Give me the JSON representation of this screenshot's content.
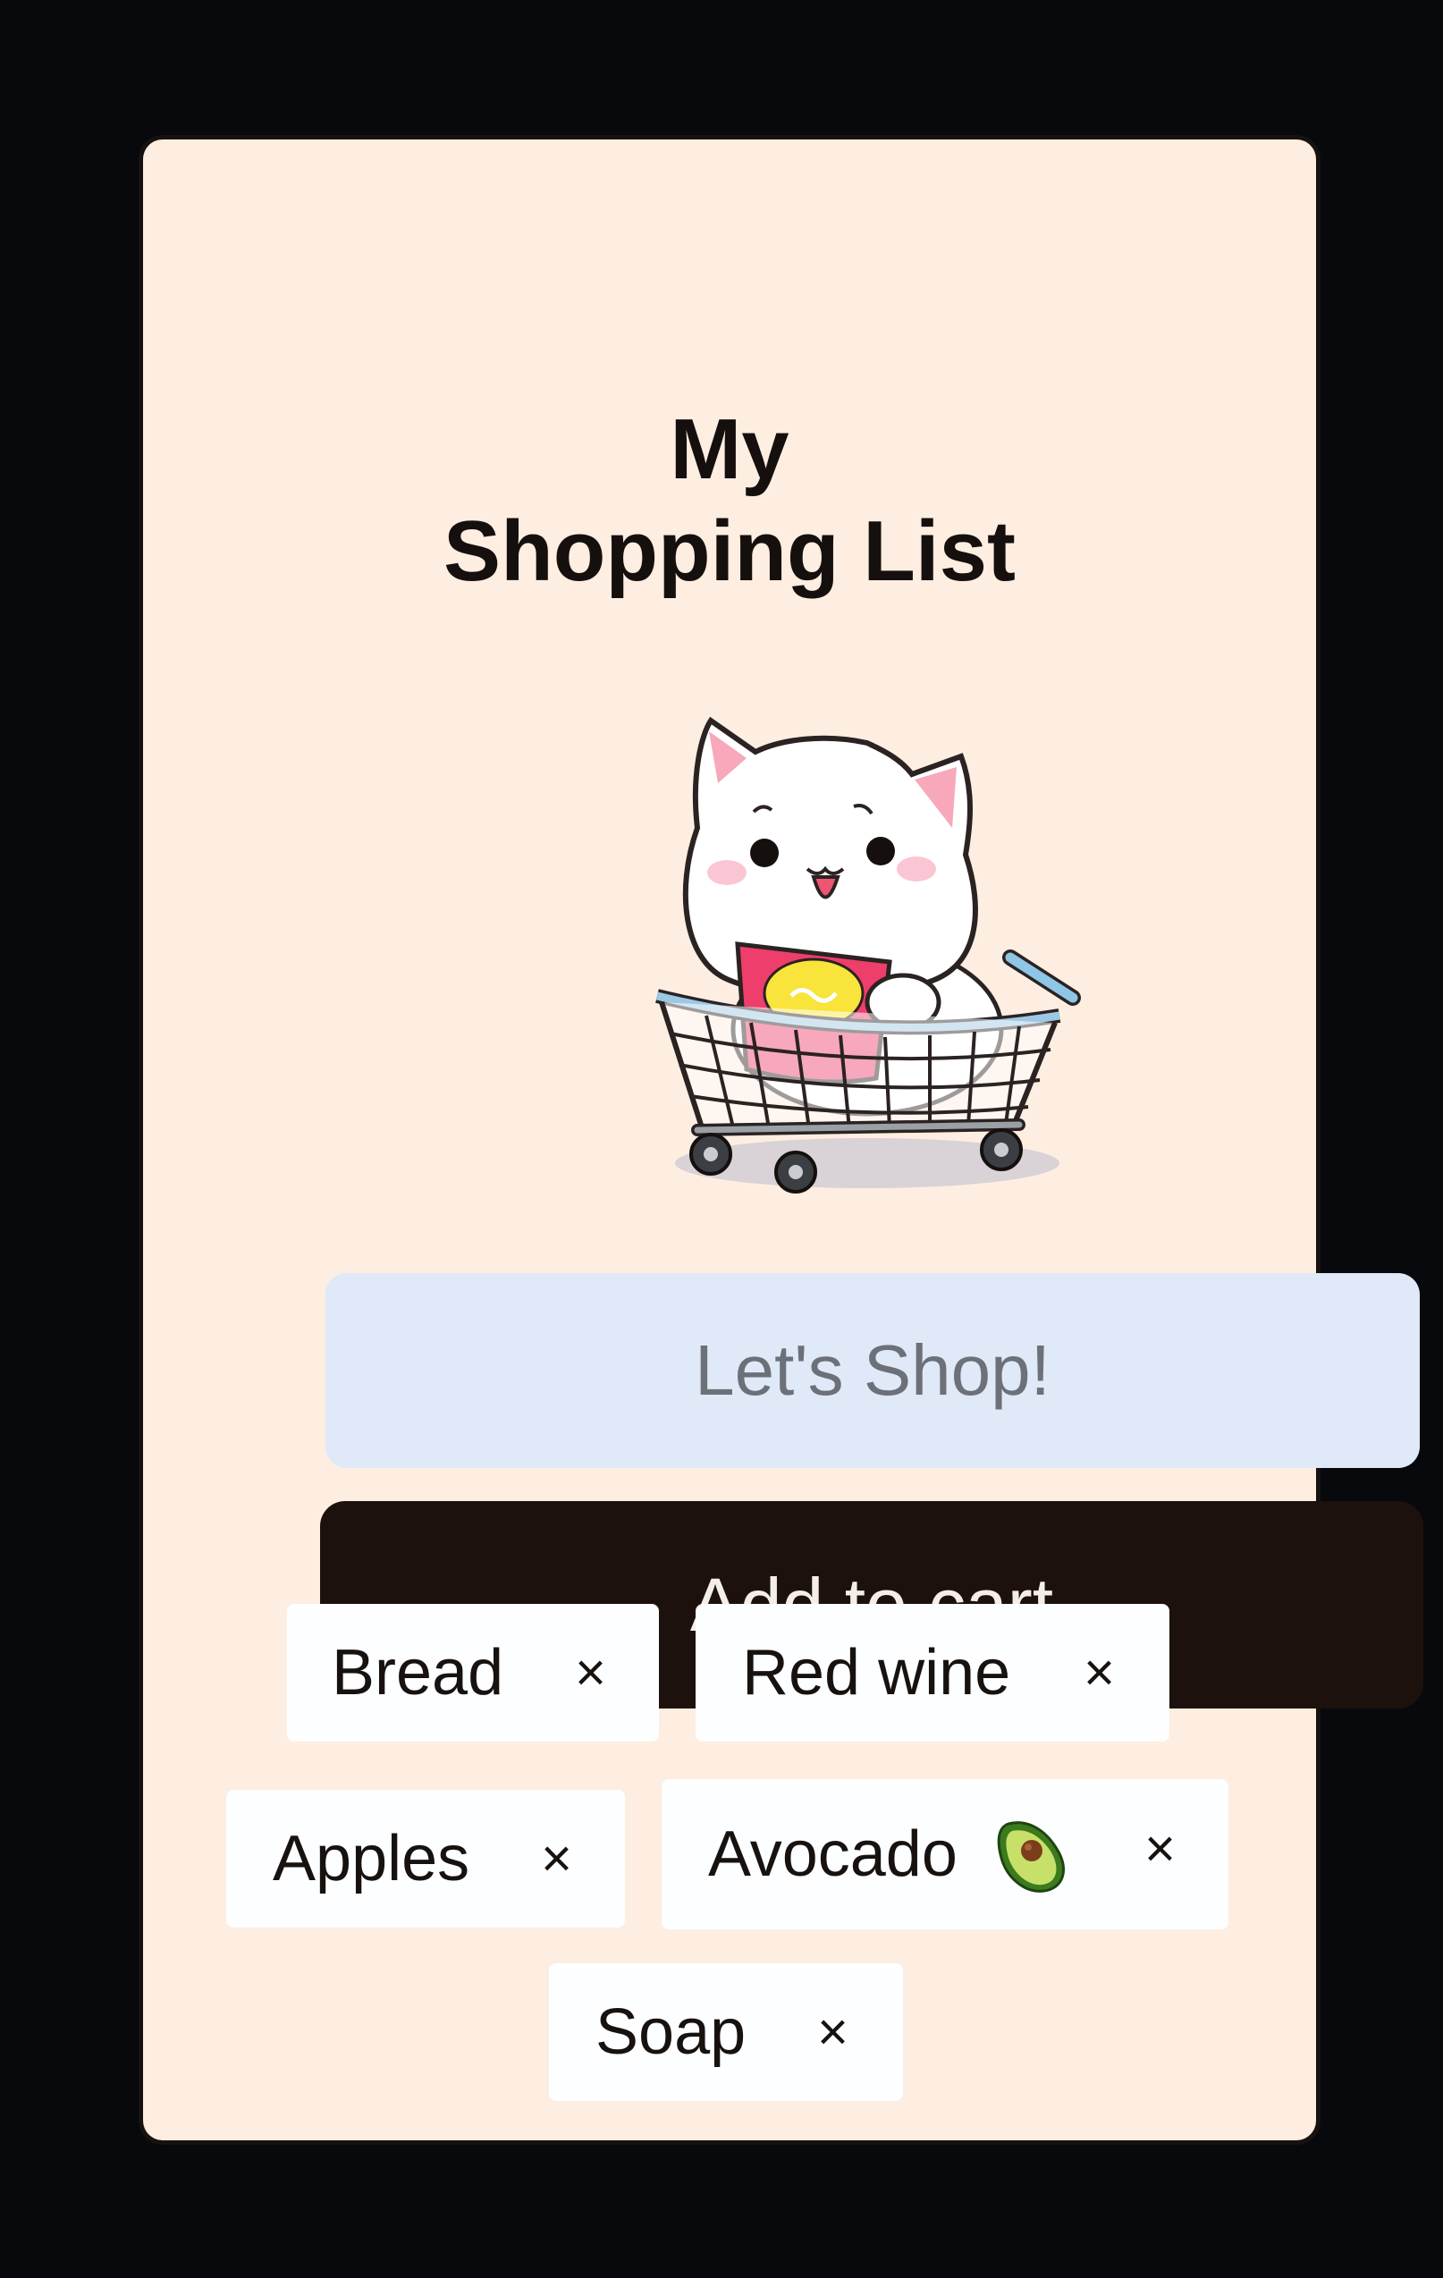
{
  "app": {
    "title_line1": "My",
    "title_line2": "Shopping List"
  },
  "mascot": {
    "icon": "cat-in-shopping-cart-icon"
  },
  "input": {
    "placeholder": "Let's Shop!",
    "value": ""
  },
  "add_button": {
    "label": "Add to cart"
  },
  "items": [
    {
      "label": "Bread",
      "remove": "×"
    },
    {
      "label": "Red wine",
      "remove": "×"
    },
    {
      "label": "Apples",
      "remove": "×"
    },
    {
      "label": "Avocado",
      "remove": "×",
      "icon": "avocado-icon"
    },
    {
      "label": "Soap",
      "remove": "×"
    }
  ],
  "colors": {
    "page_background": "#08090c",
    "card_background": "#fdeee1",
    "input_background": "#dfe9f7",
    "button_background": "#1c110d",
    "button_text": "#f4eee9",
    "chip_background": "#fdfeff"
  }
}
